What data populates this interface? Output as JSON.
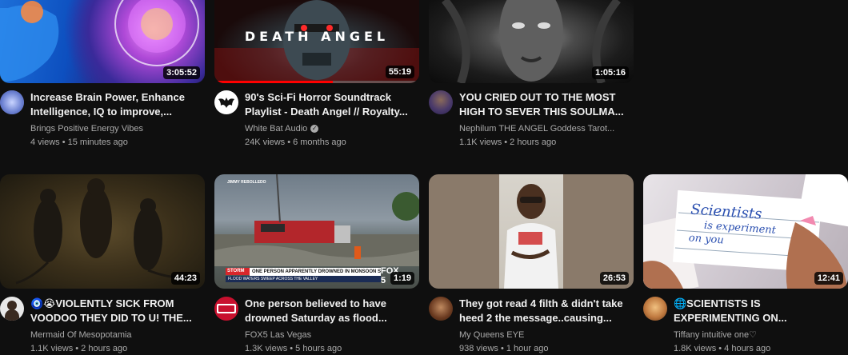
{
  "videos": [
    {
      "title": "Increase Brain Power, Enhance Intelligence, IQ to improve,...",
      "channel": "Brings Positive Energy Vibes",
      "stats": "4 views • 15 minutes ago",
      "duration": "3:05:52",
      "thumb_text": "",
      "avatar_color": "#7b8fd6"
    },
    {
      "title": "90's Sci-Fi Horror Soundtrack Playlist - Death Angel // Royalty...",
      "channel": "White Bat Audio",
      "stats": "24K views • 6 months ago",
      "duration": "55:19",
      "thumb_text": "DEATH ANGEL",
      "progress_fraction": 0.58,
      "avatar_color": "#ffffff"
    },
    {
      "title": "YOU CRIED OUT TO THE MOST HIGH TO SEVER THIS SOULMA...",
      "channel": "Nephilum THE ANGEL Goddess Tarot...",
      "stats": "1.1K views • 2 hours ago",
      "duration": "1:05:16",
      "thumb_text": "",
      "avatar_color": "#5b4a8a"
    },
    {
      "title": "🧿😭VIOLENTLY SICK FROM VOODOO THEY DID TO U! THE...",
      "channel": "Mermaid Of Mesopotamia",
      "stats": "1.1K views • 2 hours ago",
      "duration": "44:23",
      "thumb_text": "",
      "avatar_color": "#e8e8e8"
    },
    {
      "title": "One person believed to have drowned Saturday as flood...",
      "channel": "FOX5 Las Vegas",
      "stats": "1.3K views • 5 hours ago",
      "duration": "1:19",
      "thumb_text": "",
      "lower_third": "ONE PERSON APPARENTLY DROWNED IN MONSOON STORMS",
      "lower_third_sub": "FLOOD WATERS SWEEP ACROSS THE VALLEY",
      "storm_tag": "STORM",
      "fox_tag": "FOX 5",
      "reporter": "JIMMY REBOLLEDO",
      "avatar_color": "#c8102e"
    },
    {
      "title": "They got read 4 filth & didn't take heed 2 the message..causing...",
      "channel": "My Queens EYE",
      "stats": "938 views • 1 hour ago",
      "duration": "26:53",
      "thumb_text": "",
      "avatar_color": "#8a5a3a"
    },
    {
      "title": "🌐SCIENTISTS IS EXPERIMENTING ON...",
      "channel": "Tiffany intuitive one♡",
      "stats": "1.8K views • 4 hours ago",
      "duration": "12:41",
      "thumb_text": "Scientists is experimenting on you",
      "note_line1": "Scientists",
      "note_line2": "is experiment",
      "note_line3": "on you",
      "avatar_color": "#c98a4a"
    }
  ]
}
